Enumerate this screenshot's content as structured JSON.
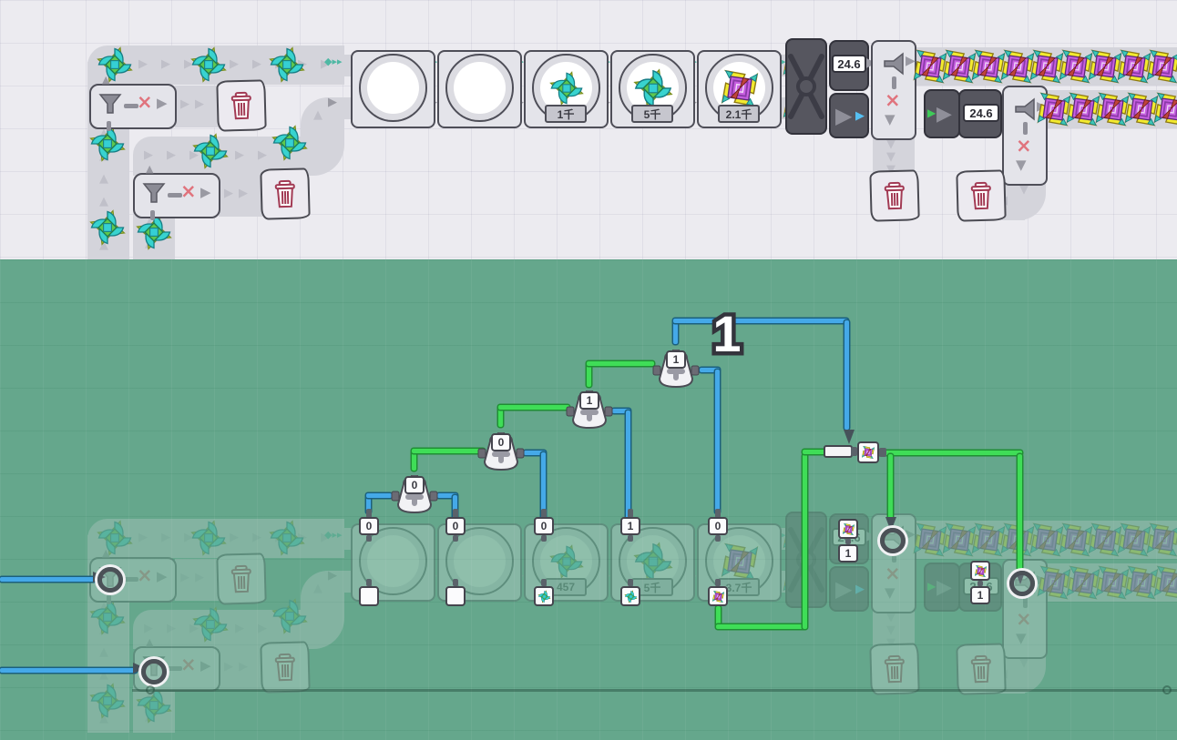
{
  "scene": {
    "description_top_layer": "factory belt view",
    "description_bottom_layer": "wires overlay view"
  },
  "colors": {
    "wire_green": "#3fdd57",
    "wire_blue": "#45a9e8",
    "overlay_green": "#65a78c",
    "belt_gray": "#d4d4db",
    "machine_dark": "#56565f",
    "error_x_red": "#e0737d",
    "trash_red": "#a23a54",
    "item_teal": "#38d3cf",
    "item_purple": "#c75fe0",
    "item_yellow": "#f2ea2f"
  },
  "icons": {
    "trash": "trash-can-icon",
    "filter": "funnel-icon",
    "discard": "x-icon",
    "flow": "arrow-icon",
    "adder": "plus-icon",
    "send": "play-triangle-icon"
  },
  "factory": {
    "machines": [
      {
        "item": "none",
        "count_label": ""
      },
      {
        "item": "none",
        "count_label": ""
      },
      {
        "item": "teal-pinwheel",
        "count_label": "1千"
      },
      {
        "item": "teal-pinwheel",
        "count_label": "5千"
      },
      {
        "item": "purple-pinwheel",
        "count_label": "2.1千"
      }
    ],
    "counter_top_value": "24.6",
    "counter_bottom_value": "24.6"
  },
  "wires_view": {
    "machines": [
      {
        "item": "none",
        "count_label": ""
      },
      {
        "item": "none",
        "count_label": ""
      },
      {
        "item": "teal-pinwheel",
        "count_label": "457"
      },
      {
        "item": "teal-pinwheel",
        "count_label": "5千"
      },
      {
        "item": "purple-pinwheel",
        "count_label": "3.7千"
      }
    ],
    "counter_top_value": "24.6",
    "counter_bottom_value": "24.6",
    "adder_tags": [
      "0",
      "0",
      "1",
      "1"
    ],
    "machine_top_tags": [
      "0",
      "0",
      "0",
      "1",
      "0"
    ],
    "machine_bottom_items": [
      "none",
      "none",
      "teal-pinwheel",
      "teal-pinwheel",
      "purple-pinwheel"
    ],
    "counter_top_tag": "1",
    "counter_bottom_tag": "1",
    "floating_wire_value": "1"
  },
  "belts": {
    "right_top_item_count": 9,
    "right_bottom_item_count": 5,
    "left_teal_item_count": 8
  }
}
